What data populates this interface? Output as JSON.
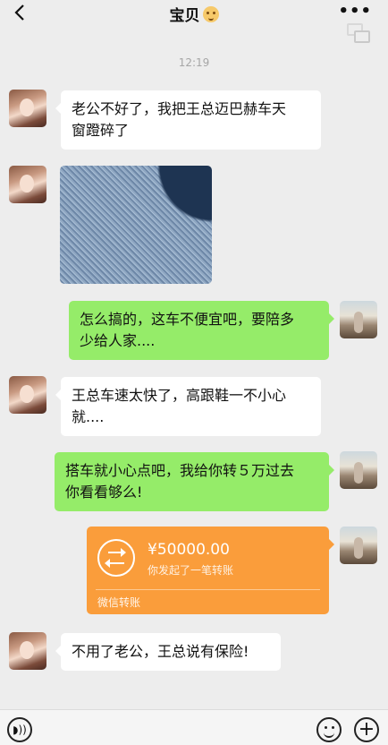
{
  "header": {
    "back_icon": "chevron-left-icon",
    "title": "宝贝",
    "title_emoji": "baby-face-emoji",
    "more_label": "•••",
    "floating_window_icon": "floating-window-icon"
  },
  "timestamp": "12:19",
  "messages": [
    {
      "side": "left",
      "type": "text",
      "line1": "老公不好了，我把王总迈巴赫车天",
      "line2": "窗蹬碎了"
    },
    {
      "side": "left",
      "type": "image",
      "icon": "shattered-glass-photo"
    },
    {
      "side": "right",
      "type": "text",
      "line1": "怎么搞的，这车不便宜吧，要陪多",
      "line2": "少给人家...."
    },
    {
      "side": "left",
      "type": "text",
      "line1": "王总车速太快了，高跟鞋一不小心",
      "line2": "就...."
    },
    {
      "side": "right",
      "type": "text",
      "line1": "搭车就小心点吧，我给你转５万过去",
      "line2": "你看看够么!"
    },
    {
      "side": "right",
      "type": "transfer",
      "amount": "¥50000.00",
      "desc": "你发起了一笔转账",
      "footer": "微信转账"
    },
    {
      "side": "left",
      "type": "text",
      "line1": "不用了老公，王总说有保险!"
    }
  ],
  "toolbar": {
    "voice_icon": "voice-icon",
    "emoji_icon": "emoji-icon",
    "plus_label": "+"
  },
  "colors": {
    "background": "#ededed",
    "sent_bubble": "#95ec69",
    "received_bubble": "#ffffff",
    "transfer_card": "#fa9d3b"
  }
}
